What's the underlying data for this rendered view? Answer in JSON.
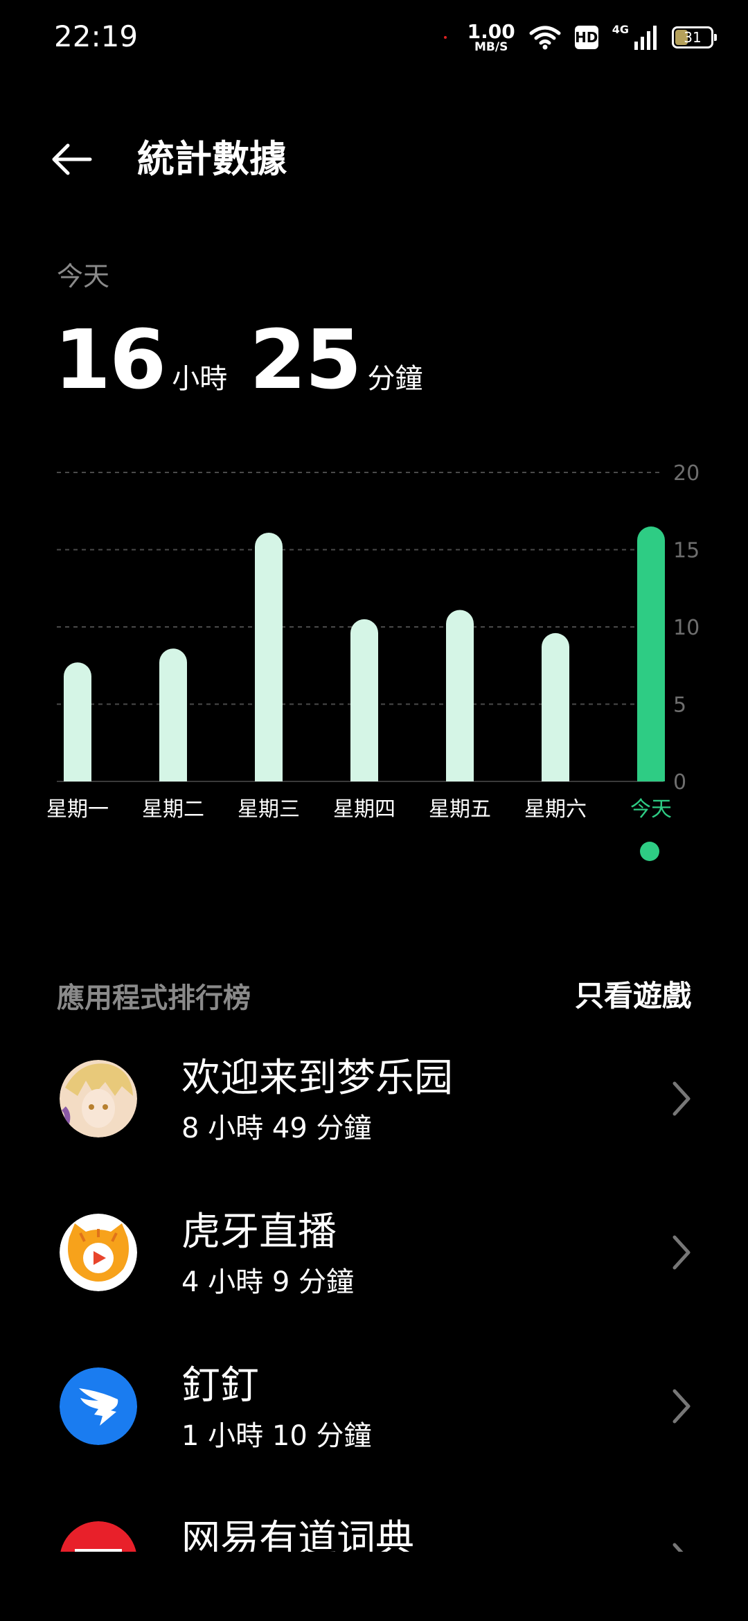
{
  "status_bar": {
    "time": "22:19",
    "net_speed_value": "1.00",
    "net_speed_unit": "MB/S",
    "hd_label": "HD",
    "net_type": "4G",
    "battery": "31"
  },
  "header": {
    "title": "統計數據"
  },
  "summary": {
    "label": "今天",
    "hours": "16",
    "hours_unit": "小時",
    "minutes": "25",
    "minutes_unit": "分鐘"
  },
  "chart_data": {
    "type": "bar",
    "categories": [
      "星期一",
      "星期二",
      "星期三",
      "星期四",
      "星期五",
      "星期六",
      "今天"
    ],
    "values": [
      7.7,
      8.6,
      16.1,
      10.5,
      11.1,
      9.6,
      16.5
    ],
    "ylim": [
      0,
      20
    ],
    "yticks": [
      "0",
      "5",
      "10",
      "15",
      "20"
    ],
    "grid": true,
    "bar_color": "#d5f5e6",
    "highlight_color": "#2ecc84",
    "highlight_index": 6
  },
  "rankings": {
    "title": "應用程式排行榜",
    "filter_label": "只看遊戲",
    "apps": [
      {
        "name": "欢迎来到梦乐园",
        "time": "8 小時 49 分鐘",
        "icon": "anime-avatar-icon"
      },
      {
        "name": "虎牙直播",
        "time": "4 小時 9 分鐘",
        "icon": "huya-tiger-icon"
      },
      {
        "name": "釘釘",
        "time": "1 小時 10 分鐘",
        "icon": "dingtalk-icon"
      },
      {
        "name": "网易有道词典",
        "time": "",
        "icon": "youdao-icon"
      }
    ]
  },
  "colors": {
    "background": "#000000",
    "accent": "#2ecc84",
    "muted_text": "#8a8a8a"
  }
}
